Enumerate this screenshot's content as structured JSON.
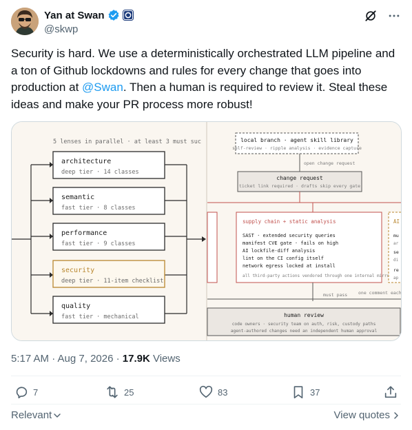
{
  "author": {
    "display_name": "Yan at Swan",
    "handle": "@skwp",
    "verified_icon": "verified-badge-icon",
    "affiliate_icon": "swan-affiliate-icon"
  },
  "tweet": {
    "text_before": "Security is hard. We use a deterministically orchestrated LLM pipeline and a ton of Github lockdowns and rules for every change that goes into production at ",
    "mention": "@Swan",
    "text_after": ". Then a human is required to review it. Steal these ideas and make your PR process more robust!"
  },
  "diagram": {
    "lenses_title": "5 lenses in parallel · at least 3 must suc",
    "lenses": [
      {
        "name": "architecture",
        "detail": "deep tier · 14 classes",
        "color": "#2b2b2b"
      },
      {
        "name": "semantic",
        "detail": "fast tier · 8 classes",
        "color": "#2b2b2b"
      },
      {
        "name": "performance",
        "detail": "fast tier · 9 classes",
        "color": "#2b2b2b"
      },
      {
        "name": "security",
        "detail": "deep tier · 11-item checklist",
        "color": "#b8862e"
      },
      {
        "name": "quality",
        "detail": "fast tier · mechanical",
        "color": "#2b2b2b"
      }
    ],
    "local_branch": {
      "title": "local branch · agent skill library",
      "sub": "self-review · ripple analysis · evidence capture"
    },
    "open_change": "open change request",
    "change_request": {
      "title": "change request",
      "sub": "ticket link required · drafts skip every gate"
    },
    "supply_chain": {
      "title": "supply chain + static analysis",
      "items": [
        "SAST · extended security queries",
        "manifest CVE gate · fails on high",
        "AI lockfile-diff analysis",
        "lint on the CI config itself",
        "network egress locked at install"
      ],
      "footer": "all third-party actions vendored through one internal mirror"
    },
    "right_partial": {
      "title": "AI",
      "lines": [
        "mu",
        "ar",
        "se",
        "di",
        "re",
        "ap"
      ]
    },
    "must_pass": "must pass",
    "one_comment": "one comment each",
    "human_review": {
      "title": "human review",
      "line1": "code owners · security team on auth, risk, custody paths",
      "line2": "agent-authored changes need an independent human approval"
    }
  },
  "meta": {
    "time": "5:17 AM · Aug 7, 2026 · ",
    "views_count": "17.9K",
    "views_label": " Views"
  },
  "actions": {
    "replies": "7",
    "reposts": "25",
    "likes": "83",
    "bookmarks": "37"
  },
  "footer": {
    "relevant": "Relevant",
    "view_quotes": "View quotes"
  },
  "colors": {
    "accent": "#1d9bf0",
    "muted": "#536471",
    "security_amber": "#b8862e",
    "supply_red": "#c0504d"
  }
}
